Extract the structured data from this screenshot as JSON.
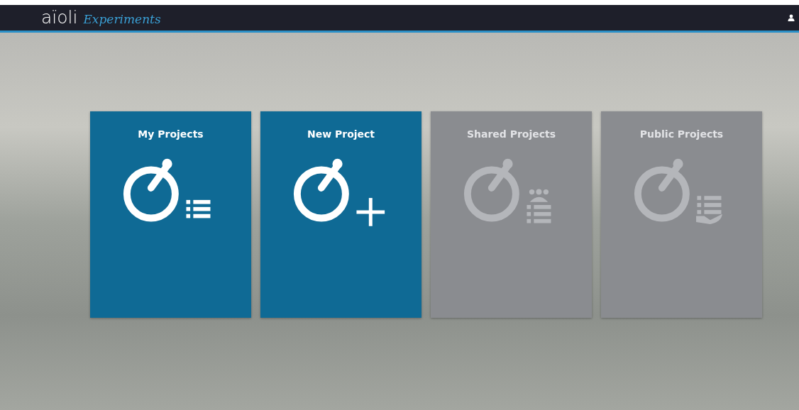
{
  "header": {
    "logo": "aïoli",
    "subtitle": "Experiments"
  },
  "cards": [
    {
      "title": "My Projects",
      "kind": "list",
      "disabled": false
    },
    {
      "title": "New Project",
      "kind": "plus",
      "disabled": false
    },
    {
      "title": "Shared Projects",
      "kind": "shared",
      "disabled": true
    },
    {
      "title": "Public Projects",
      "kind": "public",
      "disabled": true
    }
  ]
}
